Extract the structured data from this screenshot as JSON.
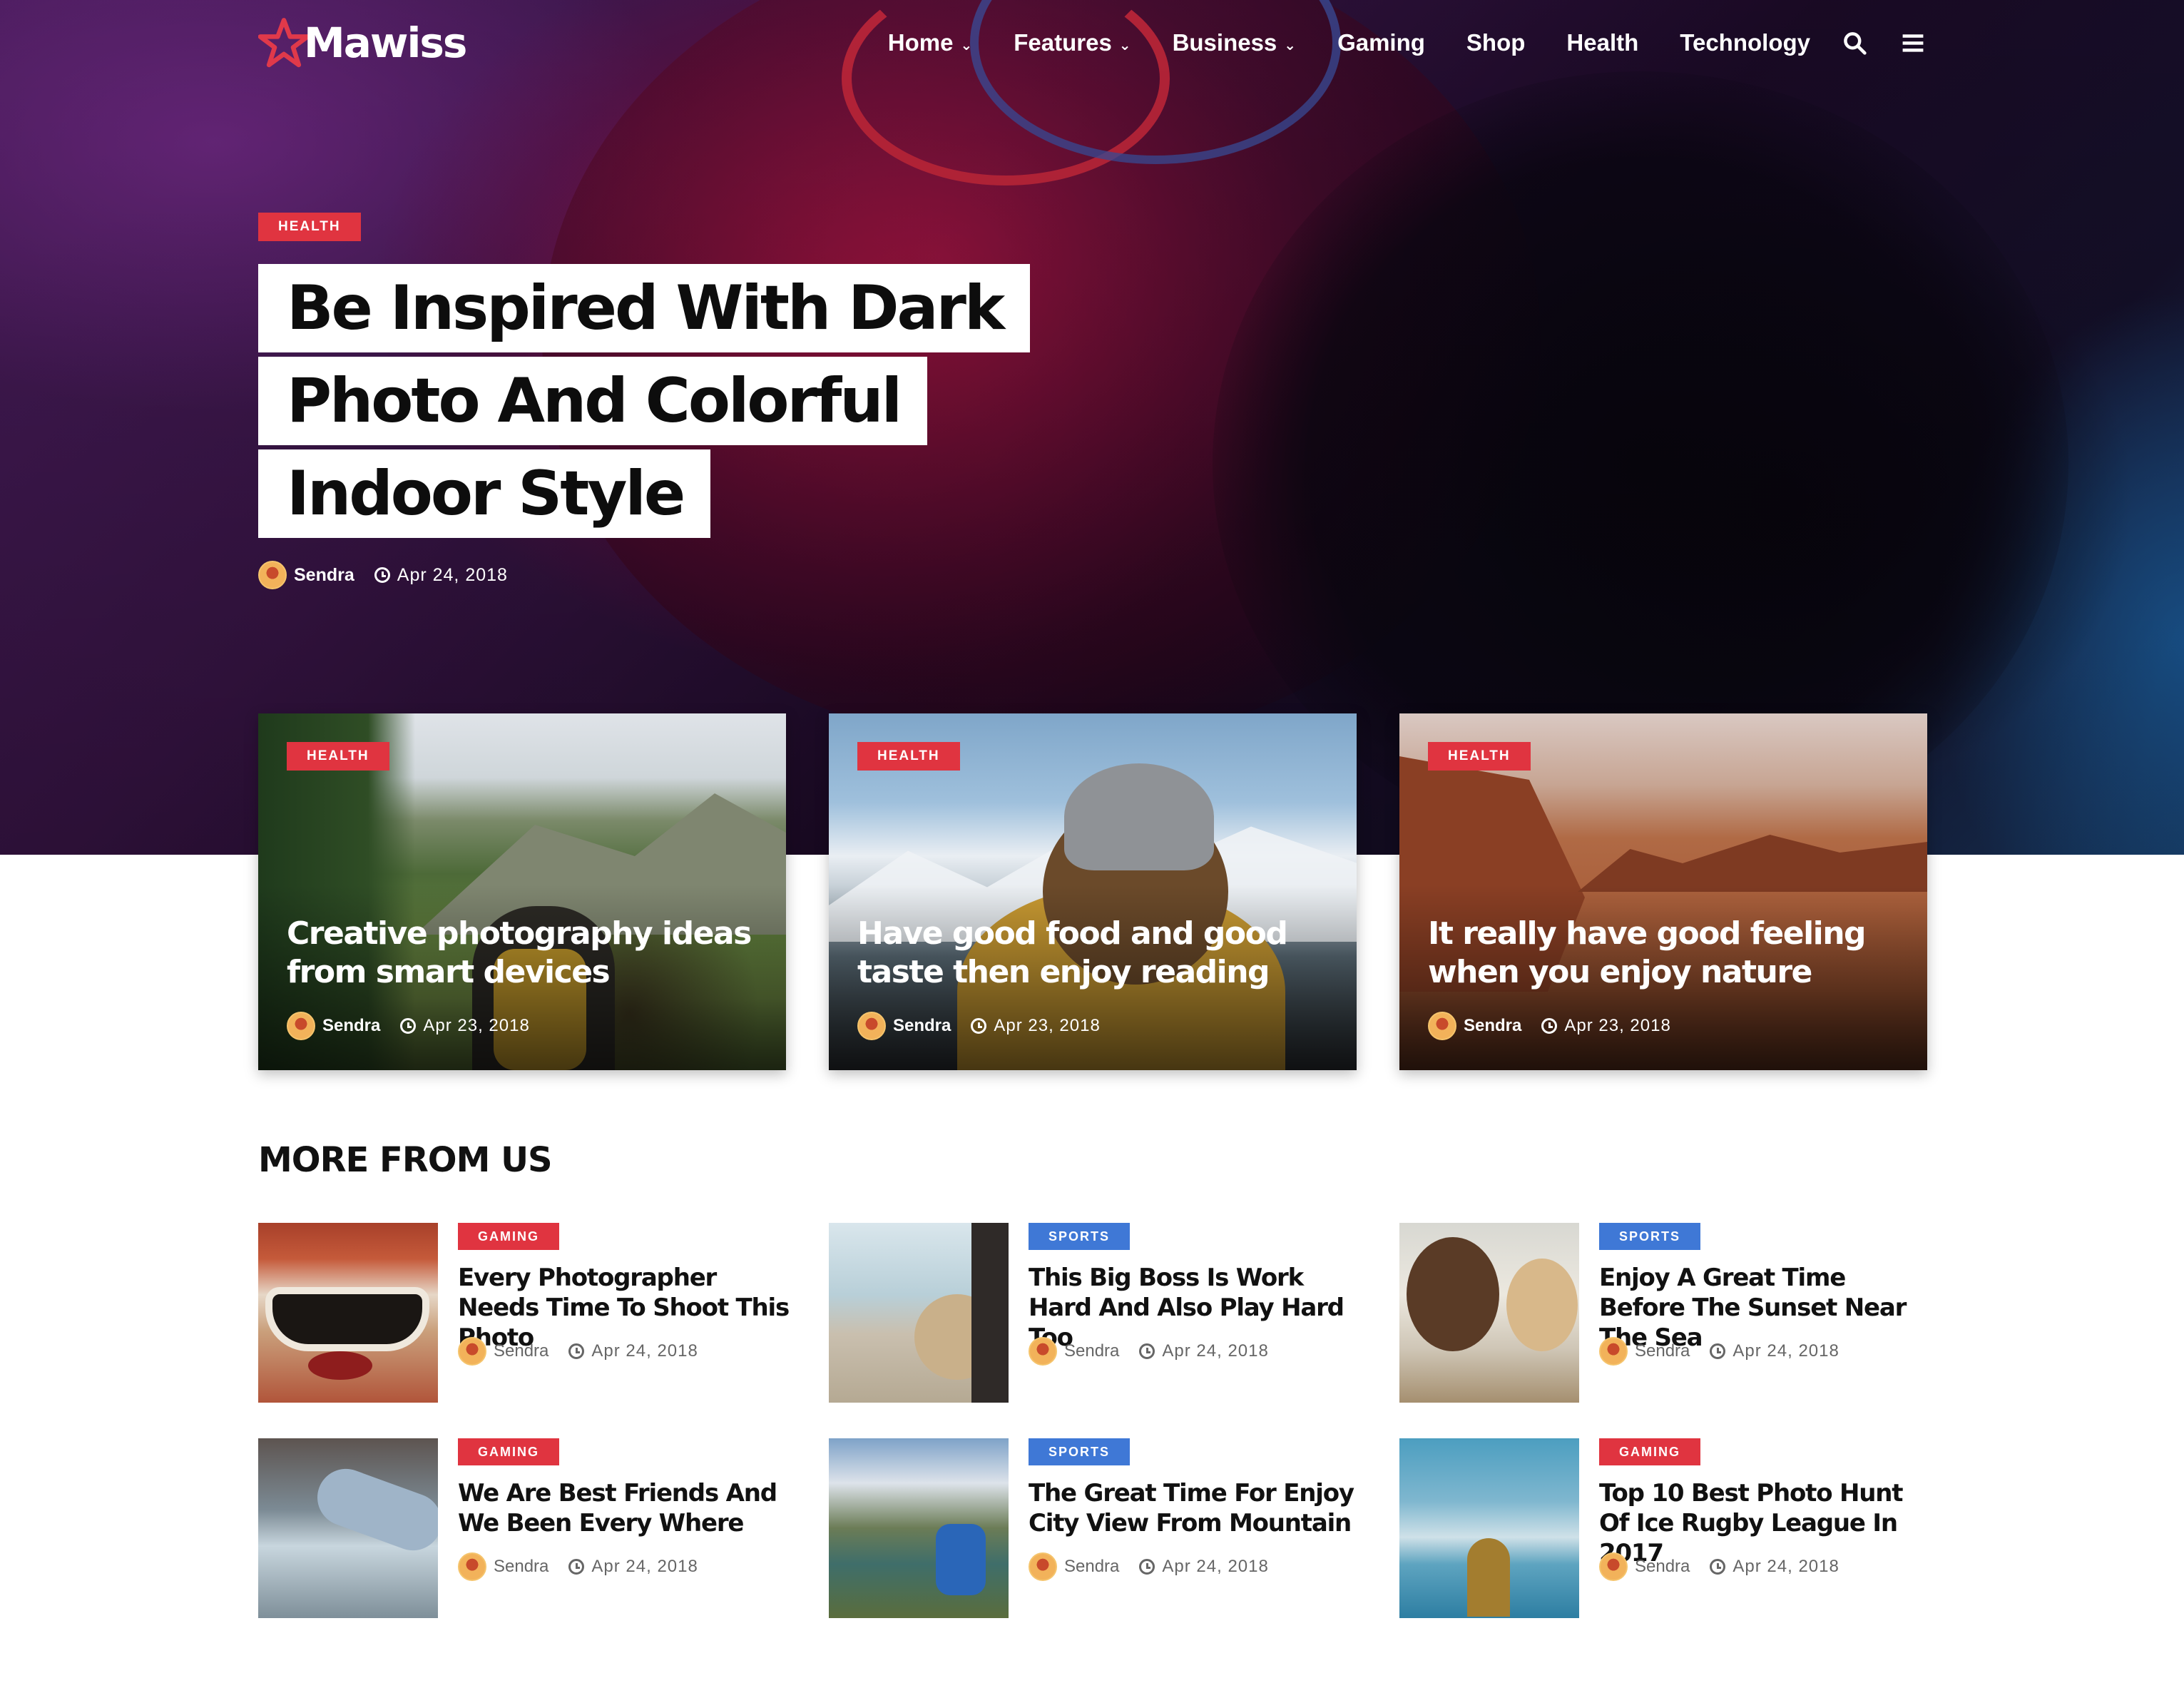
{
  "brand": {
    "name": "Mawiss",
    "accent": "#e03440",
    "blue": "#3f78d6"
  },
  "nav": {
    "items": [
      {
        "label": "Home",
        "dropdown": true
      },
      {
        "label": "Features",
        "dropdown": true
      },
      {
        "label": "Business",
        "dropdown": true
      },
      {
        "label": "Gaming",
        "dropdown": false
      },
      {
        "label": "Shop",
        "dropdown": false
      },
      {
        "label": "Health",
        "dropdown": false
      },
      {
        "label": "Technology",
        "dropdown": false
      }
    ],
    "chevron": "⌄",
    "icons": [
      "search-icon",
      "menu-icon"
    ]
  },
  "hero": {
    "category": "HEALTH",
    "title_lines": [
      "Be Inspired With Dark",
      "Photo And Colorful",
      "Indoor Style"
    ],
    "author": "Sendra",
    "date": "Apr 24, 2018"
  },
  "featured": [
    {
      "category": "HEALTH",
      "title": "Creative photography ideas from smart devices",
      "author": "Sendra",
      "date": "Apr 23, 2018"
    },
    {
      "category": "HEALTH",
      "title": "Have good food and good taste then enjoy reading",
      "author": "Sendra",
      "date": "Apr 23, 2018"
    },
    {
      "category": "HEALTH",
      "title": "It really have good feeling when you enjoy nature",
      "author": "Sendra",
      "date": "Apr 23, 2018"
    }
  ],
  "more": {
    "heading": "MORE FROM US",
    "posts": [
      {
        "category": "GAMING",
        "color": "red",
        "title": "Every Photographer Needs Time To Shoot This Photo",
        "author": "Sendra",
        "date": "Apr 24, 2018"
      },
      {
        "category": "SPORTS",
        "color": "blue",
        "title": "This Big Boss Is Work Hard And Also Play Hard Too",
        "author": "Sendra",
        "date": "Apr 24, 2018"
      },
      {
        "category": "SPORTS",
        "color": "blue",
        "title": "Enjoy A Great Time Before The Sunset Near The Sea",
        "author": "Sendra",
        "date": "Apr 24, 2018"
      },
      {
        "category": "GAMING",
        "color": "red",
        "title": "We Are Best Friends And We Been Every Where",
        "author": "Sendra",
        "date": "Apr 24, 2018"
      },
      {
        "category": "SPORTS",
        "color": "blue",
        "title": "The Great Time For Enjoy City View From Mountain",
        "author": "Sendra",
        "date": "Apr 24, 2018"
      },
      {
        "category": "GAMING",
        "color": "red",
        "title": "Top 10 Best Photo Hunt Of Ice Rugby League In 2017",
        "author": "Sendra",
        "date": "Apr 24, 2018"
      }
    ]
  }
}
